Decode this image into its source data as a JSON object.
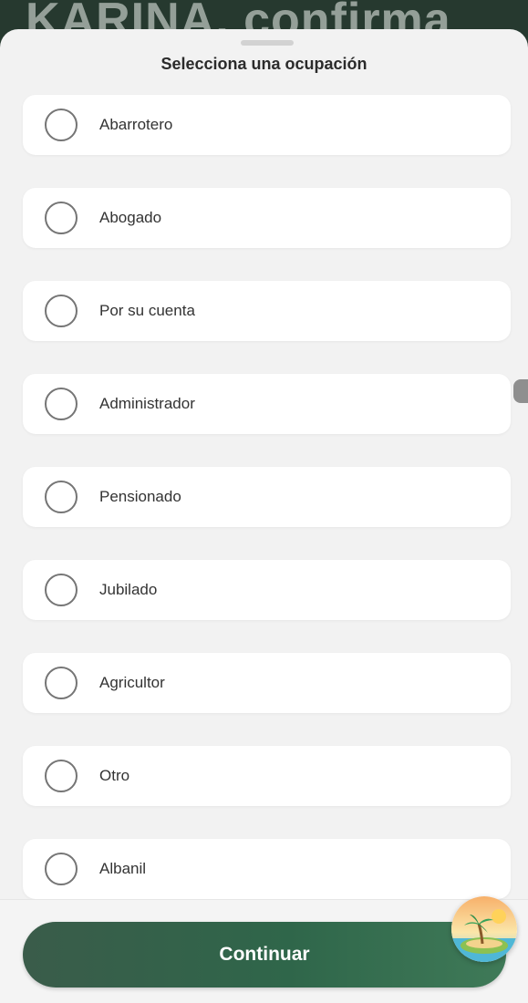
{
  "backdrop": {
    "text": "KARINA, confirma"
  },
  "sheet": {
    "title": "Selecciona una ocupación",
    "options": [
      {
        "label": "Abarrotero",
        "selected": false
      },
      {
        "label": "Abogado",
        "selected": false
      },
      {
        "label": "Por su cuenta",
        "selected": false
      },
      {
        "label": "Administrador",
        "selected": false
      },
      {
        "label": "Pensionado",
        "selected": false
      },
      {
        "label": "Jubilado",
        "selected": false
      },
      {
        "label": "Agricultor",
        "selected": false
      },
      {
        "label": "Otro",
        "selected": false
      },
      {
        "label": "Albanil",
        "selected": false
      }
    ]
  },
  "footer": {
    "continue_label": "Continuar"
  },
  "fab": {
    "icon": "beach-island-icon"
  },
  "colors": {
    "accent": "#2f664a",
    "backdrop": "#26392f",
    "sheet_background": "#f2f2f2",
    "radio_border": "#757575"
  }
}
